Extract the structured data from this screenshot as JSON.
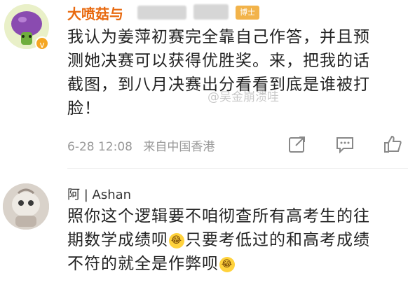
{
  "comments": [
    {
      "username": "大喷菇",
      "username_suffix": "与",
      "fan_badge": "博士",
      "verified_icon": "v-badge-icon",
      "text_lines": [
        "我认为姜萍初赛完全靠自己作答，并且预",
        "测她决赛可以获得优胜奖。来，把我的话",
        "截图，到八月决赛出分看看到底是谁被打",
        "脸！"
      ],
      "date": "6-28 12:08",
      "source": "来自中国香港",
      "actions": [
        "share-icon",
        "comment-icon",
        "like-icon"
      ]
    },
    {
      "username": "阿 | Ashan",
      "text_lines": [
        "照你这个逻辑要不咱彻查所有高考生的往",
        "期数学成绩呗",
        "只要考低过的和高考成绩",
        "不符的就全是作弊呗"
      ],
      "emoji_icon": "laughing-crying-emoji-icon"
    }
  ],
  "watermark": "@吴金崩溃哇",
  "colors": {
    "username": "#e86a10",
    "meta": "#999999",
    "badge": "#f5a623"
  }
}
